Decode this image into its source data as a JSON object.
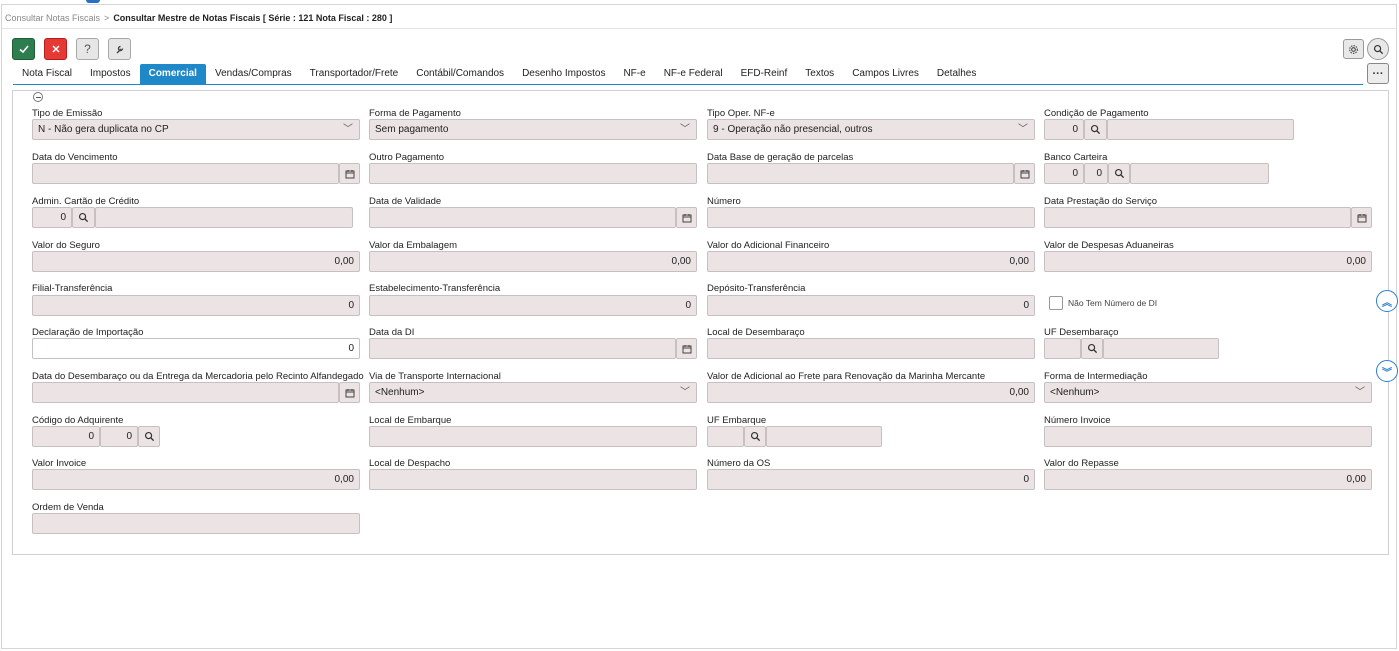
{
  "breadcrumb": {
    "parent": "Consultar Notas Fiscais",
    "separator": ">",
    "current": "Consultar Mestre de Notas Fiscais [ Série : 121 Nota Fiscal : 280 ]"
  },
  "toolbar": {
    "help_label": "?"
  },
  "tabs": [
    {
      "label": "Nota Fiscal"
    },
    {
      "label": "Impostos"
    },
    {
      "label": "Comercial"
    },
    {
      "label": "Vendas/Compras"
    },
    {
      "label": "Transportador/Frete"
    },
    {
      "label": "Contábil/Comandos"
    },
    {
      "label": "Desenho Impostos"
    },
    {
      "label": "NF-e"
    },
    {
      "label": "NF-e Federal"
    },
    {
      "label": "EFD-Reinf"
    },
    {
      "label": "Textos"
    },
    {
      "label": "Campos Livres"
    },
    {
      "label": "Detalhes"
    }
  ],
  "more_label": "···",
  "form": {
    "tipo_emissao": {
      "label": "Tipo de Emissão",
      "value": "N - Não gera duplicata no CP"
    },
    "forma_pagamento": {
      "label": "Forma de Pagamento",
      "value": "Sem pagamento"
    },
    "tipo_oper_nfe": {
      "label": "Tipo Oper. NF-e",
      "value": "9 - Operação não presencial, outros"
    },
    "condicao_pagamento": {
      "label": "Condição de Pagamento",
      "code": "0",
      "desc": ""
    },
    "data_vencimento": {
      "label": "Data do Vencimento",
      "value": ""
    },
    "outro_pagamento": {
      "label": "Outro Pagamento",
      "value": ""
    },
    "data_base_parcelas": {
      "label": "Data Base de geração de parcelas",
      "value": ""
    },
    "banco_carteira": {
      "label": "Banco Carteira",
      "code1": "0",
      "code2": "0",
      "desc": ""
    },
    "admin_cartao": {
      "label": "Admin. Cartão de Crédito",
      "code": "0",
      "desc": ""
    },
    "data_validade": {
      "label": "Data de Validade",
      "value": ""
    },
    "numero": {
      "label": "Número",
      "value": ""
    },
    "data_prestacao": {
      "label": "Data Prestação do Serviço",
      "value": ""
    },
    "valor_seguro": {
      "label": "Valor do Seguro",
      "value": "0,00"
    },
    "valor_embalagem": {
      "label": "Valor da Embalagem",
      "value": "0,00"
    },
    "valor_adicional_financeiro": {
      "label": "Valor do Adicional Financeiro",
      "value": "0,00"
    },
    "valor_despesas_aduaneiras": {
      "label": "Valor de Despesas Aduaneiras",
      "value": "0,00"
    },
    "filial_transferencia": {
      "label": "Filial-Transferência",
      "value": "0"
    },
    "estabelecimento_transferencia": {
      "label": "Estabelecimento-Transferência",
      "value": "0"
    },
    "deposito_transferencia": {
      "label": "Depósito-Transferência",
      "value": "0"
    },
    "nao_tem_numero_di": {
      "label": "Não Tem Número de DI",
      "checked": false
    },
    "declaracao_importacao": {
      "label": "Declaração de Importação",
      "value": "0"
    },
    "data_di": {
      "label": "Data da DI",
      "value": ""
    },
    "local_desembaraco": {
      "label": "Local de Desembaraço",
      "value": ""
    },
    "uf_desembaraco": {
      "label": "UF Desembaraço",
      "code": "",
      "desc": ""
    },
    "data_desembaraco": {
      "label": "Data do Desembaraço ou da Entrega da Mercadoria pelo Recinto Alfandegado",
      "value": ""
    },
    "via_transporte": {
      "label": "Via de Transporte Internacional",
      "value": "<Nenhum>"
    },
    "valor_adicional_frete": {
      "label": "Valor de Adicional ao Frete para Renovação da Marinha Mercante",
      "value": "0,00"
    },
    "forma_intermediacao": {
      "label": "Forma de Intermediação",
      "value": "<Nenhum>"
    },
    "codigo_adquirente": {
      "label": "Código do Adquirente",
      "code1": "0",
      "code2": "0"
    },
    "local_embarque": {
      "label": "Local de Embarque",
      "value": ""
    },
    "uf_embarque": {
      "label": "UF Embarque",
      "code": "",
      "desc": ""
    },
    "numero_invoice": {
      "label": "Número Invoice",
      "value": ""
    },
    "valor_invoice": {
      "label": "Valor Invoice",
      "value": "0,00"
    },
    "local_despacho": {
      "label": "Local de Despacho",
      "value": ""
    },
    "numero_os": {
      "label": "Número da OS",
      "value": "0"
    },
    "valor_repasse": {
      "label": "Valor do Repasse",
      "value": "0,00"
    },
    "ordem_venda": {
      "label": "Ordem de Venda",
      "value": ""
    }
  },
  "colors": {
    "accent": "#1f88c9",
    "ok_button": "#2e7d4f",
    "cancel_button": "#e53935",
    "readonly_field": "#ece4e4"
  },
  "icons": [
    "check-icon",
    "close-icon",
    "help-icon",
    "wrench-icon",
    "gear-icon",
    "search-icon",
    "calendar-icon",
    "chevron-down-icon",
    "chevrons-up-icon",
    "chevrons-down-icon"
  ]
}
